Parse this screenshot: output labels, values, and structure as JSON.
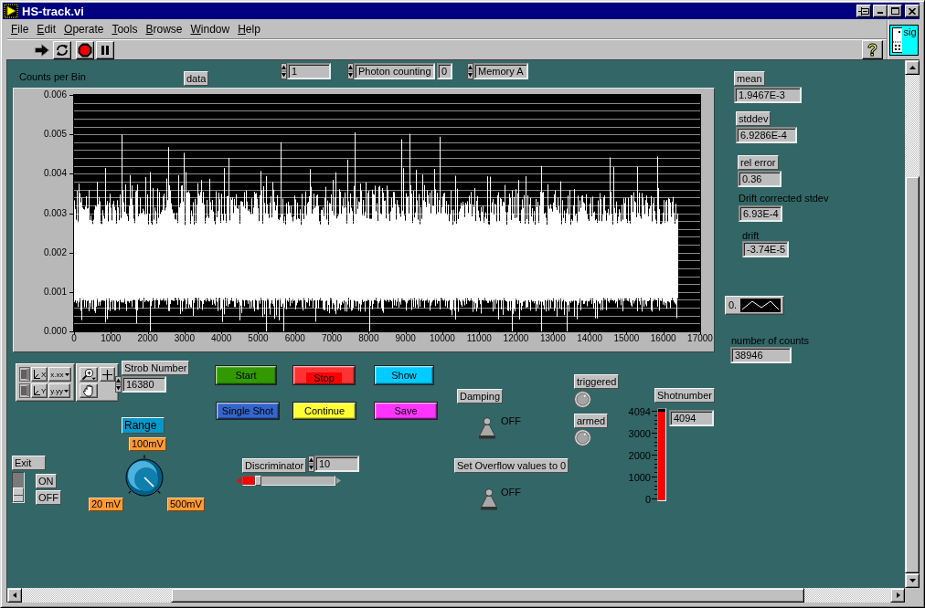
{
  "window": {
    "title": "HS-track.vi"
  },
  "menu": [
    {
      "label": "File"
    },
    {
      "label": "Edit"
    },
    {
      "label": "Operate"
    },
    {
      "label": "Tools"
    },
    {
      "label": "Browse"
    },
    {
      "label": "Window"
    },
    {
      "label": "Help"
    }
  ],
  "toolbar": {
    "help": "?"
  },
  "vi_icon": {
    "text": "sig"
  },
  "panel": {
    "selectors": [
      {
        "kind": "numeric",
        "value": "1"
      },
      {
        "kind": "ring",
        "value": "Photon counting"
      },
      {
        "kind": "display",
        "value": "0"
      },
      {
        "kind": "ring",
        "value": "Memory A"
      }
    ],
    "graph": {
      "title": "Counts per Bin",
      "label": "data",
      "y_ticks": [
        "0.006",
        "0.005",
        "0.004",
        "0.003",
        "0.002",
        "0.001",
        "0.000"
      ],
      "x_ticks": [
        "0",
        "1000",
        "2000",
        "3000",
        "4000",
        "5000",
        "6000",
        "7000",
        "8000",
        "9000",
        "10000",
        "11000",
        "12000",
        "13000",
        "14000",
        "15000",
        "16000",
        "17000"
      ]
    },
    "statistics": [
      {
        "kind": "boxed",
        "label": "mean",
        "value": "1.9467E-3"
      },
      {
        "kind": "boxed",
        "label": "stddev",
        "value": "6.9286E-4"
      },
      {
        "kind": "boxed",
        "label": "rel error",
        "value": "0.36"
      },
      {
        "kind": "plain",
        "label": "Drift corrected stdev",
        "value": "6.93E-4"
      },
      {
        "kind": "plain",
        "label": "drift",
        "value": "-3.74E-5"
      }
    ],
    "waveform_ring": {
      "value": "0."
    },
    "number_of_counts": {
      "label": "number of counts",
      "value": "38946"
    },
    "graph_palette": {
      "axes": [
        {
          "axis": "X",
          "format": "x.xx"
        },
        {
          "axis": "Y",
          "format": "y.yy"
        }
      ]
    },
    "strob_number": {
      "label": "Strob Number",
      "value": "16380"
    },
    "buttons": [
      {
        "label": "Start",
        "color": "#339900",
        "pressed": false
      },
      {
        "label": "Stop",
        "color": "#ff3333",
        "pressed": true
      },
      {
        "label": "Show",
        "color": "#00ccff",
        "pressed": false
      },
      {
        "label": "Single Shot",
        "color": "#3366cc",
        "pressed": false
      },
      {
        "label": "Continue",
        "color": "#ffff33",
        "pressed": false
      },
      {
        "label": "Save",
        "color": "#ff33ff",
        "pressed": false
      }
    ],
    "range": {
      "label": "Range",
      "marks": [
        {
          "text": "100mV",
          "selected": false
        },
        {
          "text": "20 mV",
          "selected": false
        },
        {
          "text": "500mV",
          "selected": true
        }
      ]
    },
    "exit": {
      "label": "Exit",
      "on": false,
      "on_text": "ON",
      "off_text": "OFF"
    },
    "discriminator": {
      "label": "Discriminator",
      "value": "10",
      "level": 0.14
    },
    "switches": [
      {
        "label": "Damping",
        "on": false,
        "state_text": "OFF"
      },
      {
        "label": "Set Overflow values to 0",
        "on": false,
        "state_text": "OFF"
      }
    ],
    "lights": [
      {
        "label": "triggered",
        "on": false
      },
      {
        "label": "armed",
        "on": false
      }
    ],
    "shotnumber": {
      "label": "Shotnumber",
      "value": "4094",
      "level": 0.97,
      "scale": [
        "4094",
        "3000",
        "2000",
        "1000",
        "0"
      ]
    }
  }
}
